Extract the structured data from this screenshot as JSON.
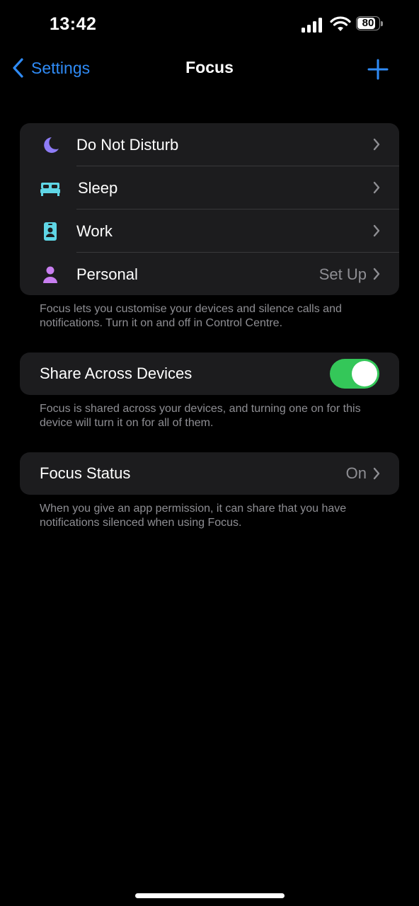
{
  "status_bar": {
    "time": "13:42",
    "battery": "80"
  },
  "nav": {
    "back_label": "Settings",
    "title": "Focus"
  },
  "focus_modes": [
    {
      "label": "Do Not Disturb",
      "icon": "moon-icon",
      "value": ""
    },
    {
      "label": "Sleep",
      "icon": "bed-icon",
      "value": ""
    },
    {
      "label": "Work",
      "icon": "id-badge-icon",
      "value": ""
    },
    {
      "label": "Personal",
      "icon": "person-icon",
      "value": "Set Up"
    }
  ],
  "focus_footnote": "Focus lets you customise your devices and silence calls and notifications. Turn it on and off in Control Centre.",
  "share": {
    "label": "Share Across Devices",
    "enabled": true,
    "footnote": "Focus is shared across your devices, and turning one on for this device will turn it on for all of them."
  },
  "status": {
    "label": "Focus Status",
    "value": "On",
    "footnote": "When you give an app permission, it can share that you have notifications silenced when using Focus."
  },
  "colors": {
    "accent": "#2f8bf6",
    "toggle_on": "#34c759",
    "moon": "#8e7cf6",
    "bed": "#5fd6e6",
    "work": "#5fd6e6",
    "personal": "#c87ef0"
  }
}
